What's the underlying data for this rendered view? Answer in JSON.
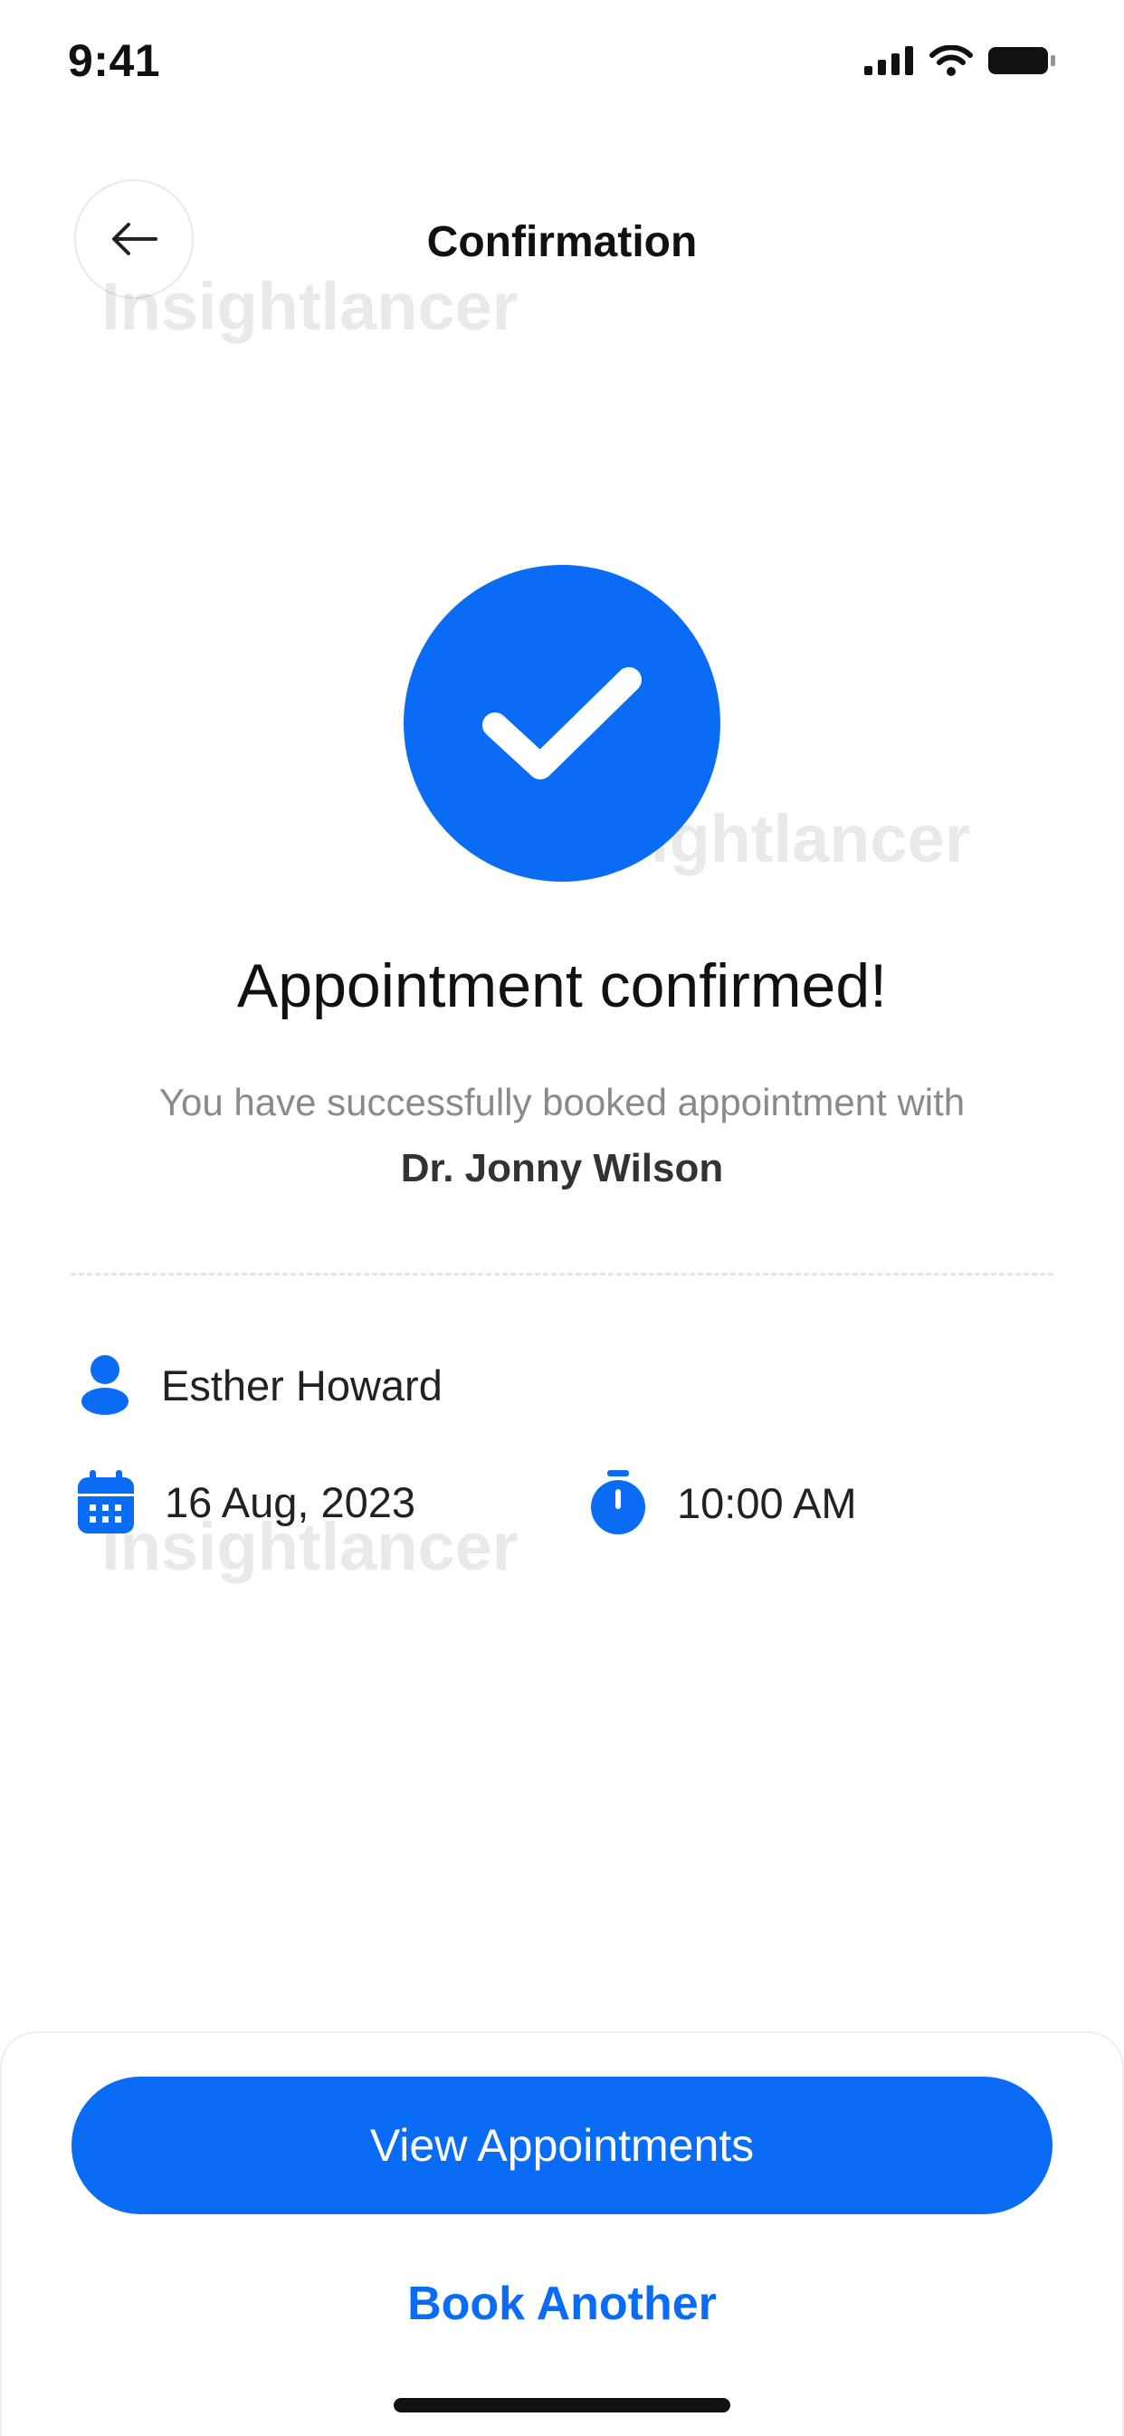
{
  "status_bar": {
    "time": "9:41"
  },
  "header": {
    "title": "Confirmation"
  },
  "watermark": "Insightlancer",
  "confirmation": {
    "headline": "Appointment confirmed!",
    "message": "You have successfully booked appointment with",
    "doctor": "Dr. Jonny Wilson"
  },
  "details": {
    "patient_name": "Esther Howard",
    "date": "16 Aug, 2023",
    "time": "10:00 AM"
  },
  "actions": {
    "primary_label": "View Appointments",
    "secondary_label": "Book Another"
  },
  "colors": {
    "accent": "#0A6CF5",
    "text": "#111111",
    "muted": "#8A8A8A"
  },
  "icons": [
    "signal-icon",
    "wifi-icon",
    "battery-icon",
    "back-arrow-icon",
    "checkmark-icon",
    "user-icon",
    "calendar-icon",
    "stopwatch-icon"
  ]
}
